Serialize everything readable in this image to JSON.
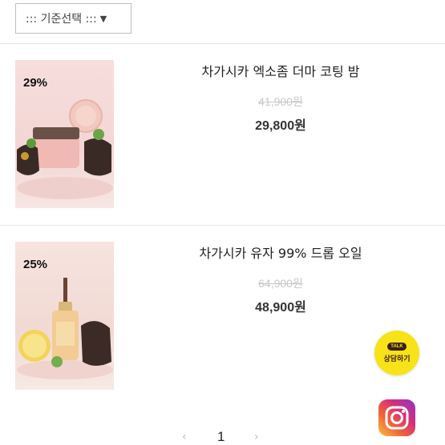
{
  "sort": {
    "label": "::: 기준선택 :::",
    "arrow": "▼"
  },
  "products": [
    {
      "discount": "29%",
      "name": "차가시카 엑소좀 더마 코팅 밤",
      "original_price": "41,900원",
      "price": "29,800원"
    },
    {
      "discount": "25%",
      "name": "차가시카 유자 99% 드롭 오일",
      "original_price": "64,900원",
      "price": "48,900원"
    }
  ],
  "kakao": {
    "badge": "TALK",
    "label": "상담하기",
    "color": "#f7e317"
  },
  "instagram": {
    "icon": "instagram-icon"
  },
  "pagination": {
    "prev": "‹",
    "current": "1",
    "next": "›"
  }
}
